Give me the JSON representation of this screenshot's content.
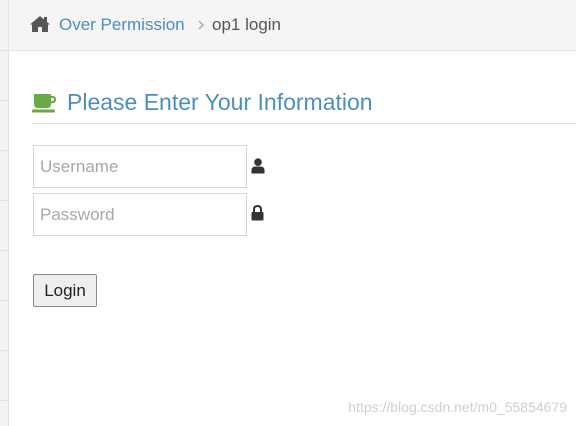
{
  "breadcrumbs": {
    "home_icon": "home-icon",
    "link_label": "Over Permission",
    "separator_icon": "chevron-right-icon",
    "current_label": "op1 login"
  },
  "header": {
    "icon": "coffee-icon",
    "title": "Please Enter Your Information"
  },
  "form": {
    "username": {
      "value": "",
      "placeholder": "Username",
      "icon": "user-icon"
    },
    "password": {
      "value": "",
      "placeholder": "Password",
      "icon": "lock-icon"
    },
    "login_label": "Login"
  },
  "watermark": "https://blog.csdn.net/m0_55854679",
  "colors": {
    "link": "#4c8fbd",
    "coffee_icon": "#69aa46",
    "breadcrumb_bg": "#f5f5f5"
  }
}
